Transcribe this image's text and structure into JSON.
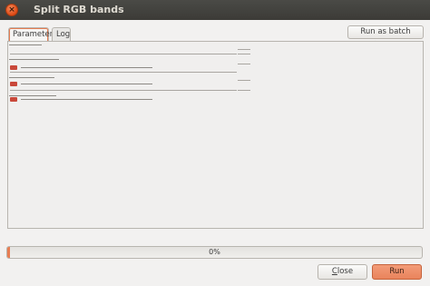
{
  "window": {
    "title": "Split RGB bands",
    "close_glyph": "×",
    "close_icon": "close-icon"
  },
  "tabs": [
    {
      "label": "Parameters",
      "active": true
    },
    {
      "label": "Log",
      "active": false
    }
  ],
  "toolbar": {
    "batch_label": "Run as batch process..."
  },
  "progress": {
    "value": 0,
    "text": "0%"
  },
  "footer": {
    "close_accel": "C",
    "close_rest": "lose",
    "run_label": "Run"
  },
  "colors": {
    "accent": "#e77d52",
    "titlebar": "#3c3b37",
    "checkbox_red": "#c9483a"
  }
}
